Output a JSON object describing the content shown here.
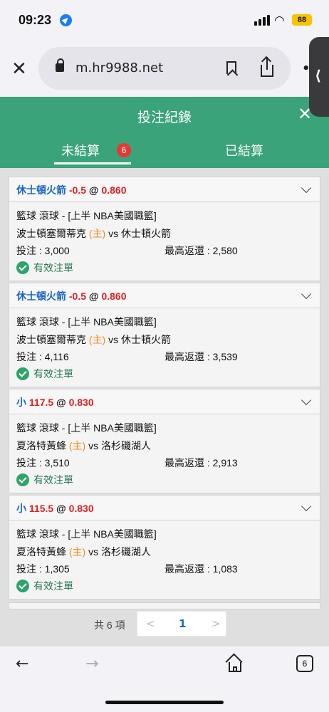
{
  "status_bar": {
    "time": "09:23",
    "battery": "88"
  },
  "browser": {
    "url": "m.hr9988.net",
    "tab_count": "6"
  },
  "header": {
    "title": "投注紀錄"
  },
  "tabs": [
    {
      "label": "未結算",
      "badge": "6"
    },
    {
      "label": "已結算"
    }
  ],
  "bets": [
    {
      "team": "休士頓火箭",
      "handicap": "-0.5",
      "at": "@",
      "odds": "0.860",
      "league": "籃球 滾球 - [上半 NBA美國職籃]",
      "home_team": "波士頓塞爾蒂克",
      "home_tag": "(主)",
      "vs": "vs",
      "away_team": "休士頓火箭",
      "stake": "投注 : 3,000",
      "max_return": "最高返還 : 2,580",
      "status": "有效注單"
    },
    {
      "team": "休士頓火箭",
      "handicap": "-0.5",
      "at": "@",
      "odds": "0.860",
      "league": "籃球 滾球 - [上半 NBA美國職籃]",
      "home_team": "波士頓塞爾蒂克",
      "home_tag": "(主)",
      "vs": "vs",
      "away_team": "休士頓火箭",
      "stake": "投注 : 4,116",
      "max_return": "最高返還 : 3,539",
      "status": "有效注單"
    },
    {
      "team": "小",
      "handicap": "117.5",
      "at": "@",
      "odds": "0.830",
      "league": "籃球 滾球 - [上半 NBA美國職籃]",
      "home_team": "夏洛特黃蜂",
      "home_tag": "(主)",
      "vs": "vs",
      "away_team": "洛杉磯湖人",
      "stake": "投注 : 3,510",
      "max_return": "最高返還 : 2,913",
      "status": "有效注單"
    },
    {
      "team": "小",
      "handicap": "115.5",
      "at": "@",
      "odds": "0.830",
      "league": "籃球 滾球 - [上半 NBA美國職籃]",
      "home_team": "夏洛特黃蜂",
      "home_tag": "(主)",
      "vs": "vs",
      "away_team": "洛杉磯湖人",
      "stake": "投注 : 1,305",
      "max_return": "最高返還 : 1,083",
      "status": "有效注單"
    }
  ],
  "pagination": {
    "total": "共 6 項",
    "prev": "<",
    "page": "1",
    "next": ">"
  },
  "colors": {
    "header_green": "#3aa37a",
    "team_blue": "#1a66cc",
    "odds_red": "#e02020",
    "home_orange": "#ef8a1b",
    "valid_green": "#2ea36b"
  }
}
